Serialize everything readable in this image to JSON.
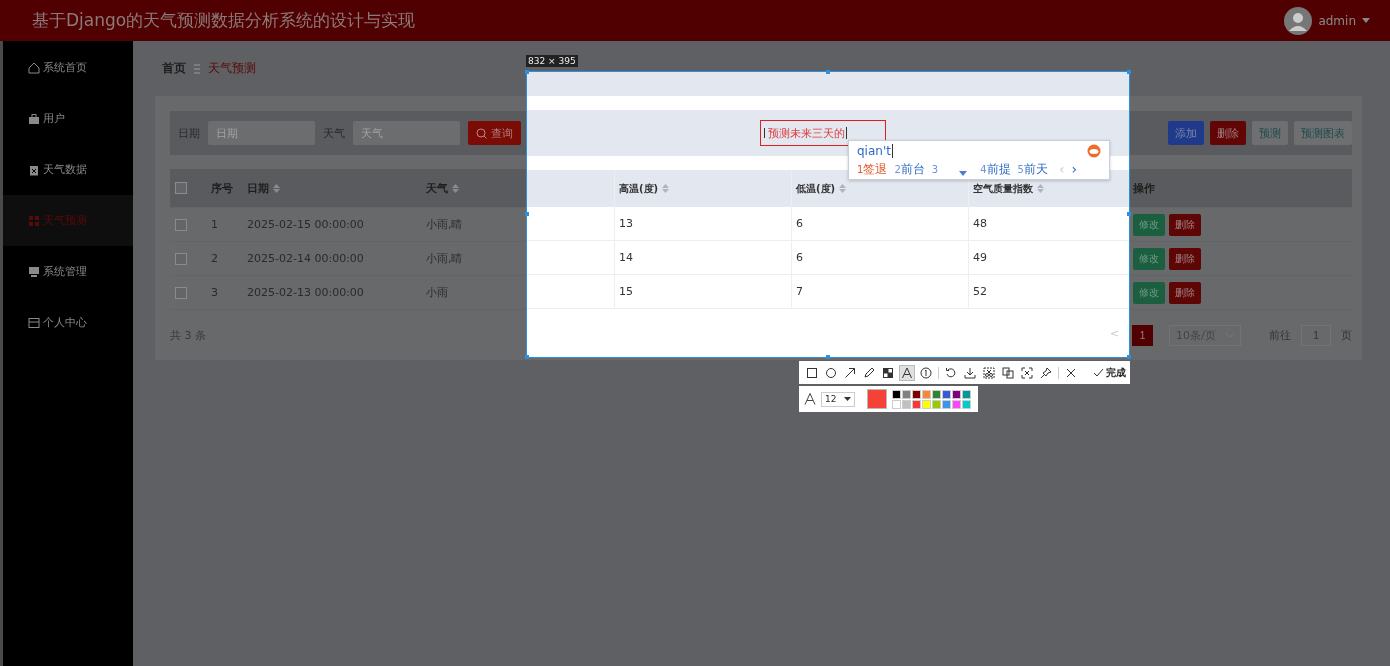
{
  "header": {
    "title": "基于Django的天气预测数据分析系统的设计与实现",
    "user": "admin"
  },
  "sidebar": {
    "items": [
      {
        "label": "系统首页",
        "selected": false
      },
      {
        "label": "用户",
        "selected": false
      },
      {
        "label": "天气数据",
        "selected": false
      },
      {
        "label": "天气预测",
        "selected": true
      },
      {
        "label": "系统管理",
        "selected": false
      },
      {
        "label": "个人中心",
        "selected": false
      }
    ]
  },
  "breadcrumb": [
    "首页",
    "天气预测"
  ],
  "search": {
    "fields": [
      {
        "label": "日期",
        "placeholder": "日期"
      },
      {
        "label": "天气",
        "placeholder": "天气"
      }
    ],
    "button": "查询"
  },
  "actions": [
    {
      "label": "添加",
      "kind": "primary"
    },
    {
      "label": "删除",
      "kind": "danger"
    },
    {
      "label": "预测",
      "kind": "plain"
    },
    {
      "label": "预测图表",
      "kind": "plain"
    }
  ],
  "table": {
    "header_checked": false,
    "columns": [
      "序号",
      "日期",
      "天气",
      "高温(度)",
      "低温(度)",
      "空气质量指数",
      "操作"
    ],
    "rows": [
      {
        "checked": false,
        "cells": [
          "1",
          "2025-02-15 00:00:00",
          "小雨,晴",
          "13",
          "6",
          "48"
        ],
        "actions": [
          "修改",
          "删除"
        ]
      },
      {
        "checked": false,
        "cells": [
          "2",
          "2025-02-14 00:00:00",
          "小雨,晴",
          "14",
          "6",
          "49"
        ],
        "actions": [
          "修改",
          "删除"
        ]
      },
      {
        "checked": false,
        "cells": [
          "3",
          "2025-02-13 00:00:00",
          "小雨",
          "15",
          "7",
          "52"
        ],
        "actions": [
          "修改",
          "删除"
        ]
      }
    ]
  },
  "pagination": {
    "total": "共 3 条",
    "prev": "<",
    "pages": [
      {
        "label": "1",
        "selected": true
      }
    ],
    "page_size": "10条/页",
    "goto_label": "前往",
    "goto_value": "1",
    "goto_suffix": "页"
  },
  "screenshot_tool": {
    "size": "832 × 395",
    "text_annotation": "预测未来三天的",
    "tools": [
      {
        "kind": "rect",
        "selected": false
      },
      {
        "kind": "ellipse",
        "selected": false
      },
      {
        "kind": "arrow",
        "selected": false
      },
      {
        "kind": "pencil",
        "selected": false
      },
      {
        "kind": "mosaic",
        "selected": false
      },
      {
        "kind": "text",
        "selected": true
      },
      {
        "kind": "number",
        "selected": false
      },
      {
        "kind": "undo",
        "selected": false
      },
      {
        "kind": "download",
        "selected": false
      },
      {
        "kind": "cut",
        "selected": false
      },
      {
        "kind": "copy",
        "selected": false
      },
      {
        "kind": "scan",
        "selected": false
      },
      {
        "kind": "pin",
        "selected": false
      },
      {
        "kind": "close",
        "selected": false
      }
    ],
    "done": "完成",
    "font_size": "12",
    "current_color": {
      "color": "#f44336"
    },
    "palette": [
      {
        "color": "#000000"
      },
      {
        "color": "#808080"
      },
      {
        "color": "#800000"
      },
      {
        "color": "#f7883a"
      },
      {
        "color": "#308430"
      },
      {
        "color": "#385ad3"
      },
      {
        "color": "#800080"
      },
      {
        "color": "#009999"
      },
      {
        "color": "#ffffff"
      },
      {
        "color": "#c0c0c0"
      },
      {
        "color": "#fb3838"
      },
      {
        "color": "#ffff00"
      },
      {
        "color": "#99cc00"
      },
      {
        "color": "#3d95ea"
      },
      {
        "color": "#ff44ff"
      },
      {
        "color": "#00cccc"
      }
    ]
  },
  "ime": {
    "input": "qian't",
    "candidates": [
      {
        "index": "1",
        "text": "签退",
        "selected": true
      },
      {
        "index": "2",
        "text": "前台",
        "selected": false
      },
      {
        "index": "3",
        "selected": false
      },
      {
        "index": "4",
        "text": "前提",
        "selected": false
      },
      {
        "index": "5",
        "text": "前天",
        "selected": false
      }
    ],
    "prev": "‹",
    "next": "›"
  }
}
